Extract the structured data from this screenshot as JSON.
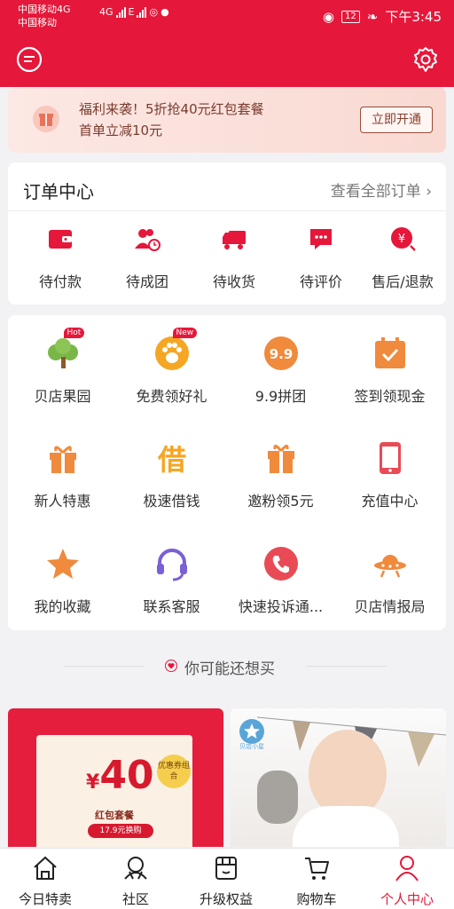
{
  "status_bar": {
    "carrier_line1": "中国移动4G",
    "carrier_line2": "中国移动",
    "network_4g": "4G",
    "network_e": "E",
    "battery": "12",
    "time": "下午3:45"
  },
  "promo": {
    "line1": "福利来袭！5折抢40元红包套餐",
    "line2": "首单立减10元",
    "button": "立即开通"
  },
  "orders": {
    "title": "订单中心",
    "view_all": "查看全部订单",
    "items": [
      {
        "label": "待付款",
        "icon": "wallet-icon"
      },
      {
        "label": "待成团",
        "icon": "group-clock-icon"
      },
      {
        "label": "待收货",
        "icon": "truck-icon"
      },
      {
        "label": "待评价",
        "icon": "comment-icon"
      },
      {
        "label": "售后/退款",
        "icon": "refund-icon"
      }
    ]
  },
  "services": [
    {
      "label": "贝店果园",
      "icon": "tree-icon",
      "tag": "Hot"
    },
    {
      "label": "免费领好礼",
      "icon": "paw-icon",
      "tag": "New"
    },
    {
      "label": "9.9拼团",
      "icon": "nine-nine-icon",
      "badge_text": "9.9"
    },
    {
      "label": "签到领现金",
      "icon": "calendar-check-icon"
    },
    {
      "label": "新人特惠",
      "icon": "gift-icon"
    },
    {
      "label": "极速借钱",
      "icon": "borrow-icon",
      "badge_text": "借"
    },
    {
      "label": "邀粉领5元",
      "icon": "gift-box-icon"
    },
    {
      "label": "充值中心",
      "icon": "phone-icon"
    },
    {
      "label": "我的收藏",
      "icon": "star-icon"
    },
    {
      "label": "联系客服",
      "icon": "headset-icon"
    },
    {
      "label": "快速投诉通...",
      "icon": "complaint-phone-icon"
    },
    {
      "label": "贝店情报局",
      "icon": "ufo-icon"
    }
  ],
  "recommend": {
    "title": "你可能还想买",
    "left_tile": {
      "currency": "¥",
      "amount": "40",
      "name": "红包套餐",
      "tag": "优惠券组合",
      "price_note": "17.9元换购"
    },
    "right_tile": {
      "badge": "贝店小星"
    }
  },
  "tabbar": {
    "tabs": [
      {
        "label": "今日特卖",
        "icon": "home-icon"
      },
      {
        "label": "社区",
        "icon": "community-icon"
      },
      {
        "label": "升级权益",
        "icon": "shop-icon"
      },
      {
        "label": "购物车",
        "icon": "cart-icon"
      },
      {
        "label": "个人中心",
        "icon": "person-icon",
        "active": true
      }
    ]
  },
  "colors": {
    "brand_red": "#e5173a",
    "orange": "#f08a3c",
    "purple": "#7b5fd6"
  }
}
